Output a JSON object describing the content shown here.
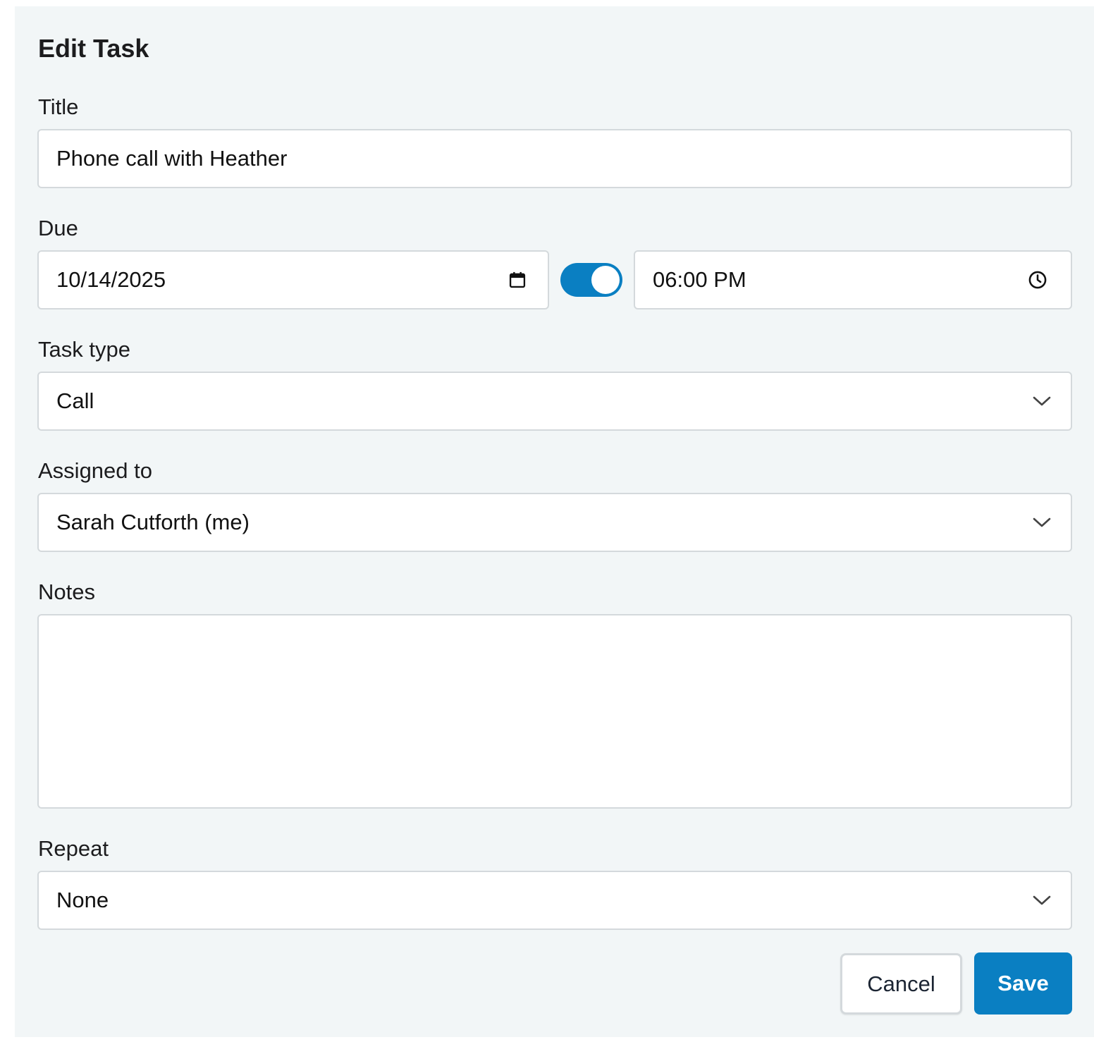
{
  "form": {
    "title": "Edit Task",
    "title_label": "Title",
    "title_value": "Phone call with Heather",
    "due_label": "Due",
    "due_date_value": "10/14/2025",
    "due_time_enabled": true,
    "due_time_value": "06:00 PM",
    "task_type_label": "Task type",
    "task_type_value": "Call",
    "assigned_label": "Assigned to",
    "assigned_value": "Sarah Cutforth (me)",
    "notes_label": "Notes",
    "notes_value": "",
    "repeat_label": "Repeat",
    "repeat_value": "None"
  },
  "actions": {
    "cancel_label": "Cancel",
    "save_label": "Save"
  },
  "icons": {
    "date": "calendar-icon",
    "time": "clock-icon",
    "dropdown": "chevron-down-icon"
  },
  "colors": {
    "accent": "#0a7fc2",
    "panel_background": "#f2f6f7",
    "field_border": "#d4d9dc"
  }
}
